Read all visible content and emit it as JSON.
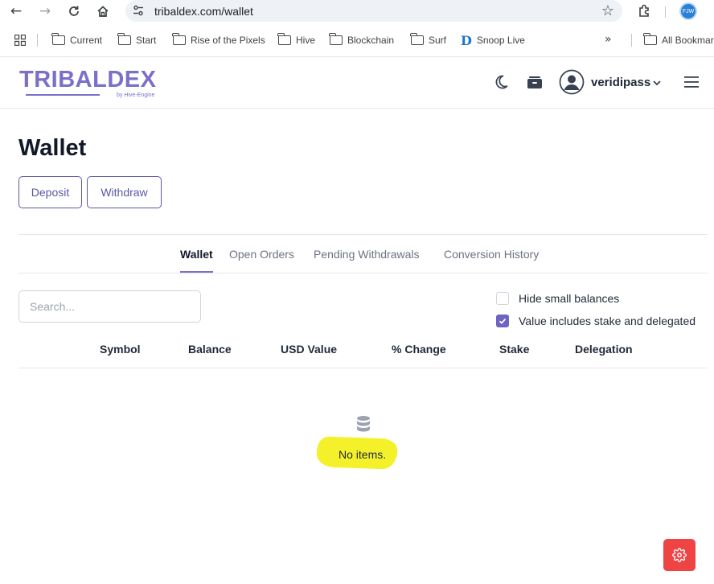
{
  "browser": {
    "url": "tribaldex.com/wallet",
    "profile_badge": "FJW",
    "bookmarks": [
      "Current",
      "Start",
      "Rise of the Pixels",
      "Hive",
      "Blockchain",
      "Surf",
      "Snoop Live"
    ],
    "bookmarks_overflow": "All Bookmarks"
  },
  "header": {
    "logo_text": "TRIBALDEX",
    "logo_sub": "by Hive-Engine",
    "username": "veridipass"
  },
  "main": {
    "title": "Wallet",
    "deposit_label": "Deposit",
    "withdraw_label": "Withdraw",
    "tabs": [
      {
        "label": "Wallet",
        "active": true
      },
      {
        "label": "Open Orders",
        "active": false
      },
      {
        "label": "Pending Withdrawals",
        "active": false
      },
      {
        "label": "Conversion History",
        "active": false
      }
    ],
    "search_placeholder": "Search...",
    "options": [
      {
        "label": "Hide small balances",
        "checked": false
      },
      {
        "label": "Value includes stake and delegated",
        "checked": true
      }
    ],
    "columns": [
      "Symbol",
      "Balance",
      "USD Value",
      "% Change",
      "Stake",
      "Delegation"
    ],
    "empty_text": "No items."
  },
  "colors": {
    "accent": "#7b70c9",
    "button_border": "#5b57a3",
    "fab": "#ef4444",
    "highlight": "#f4f12a"
  }
}
